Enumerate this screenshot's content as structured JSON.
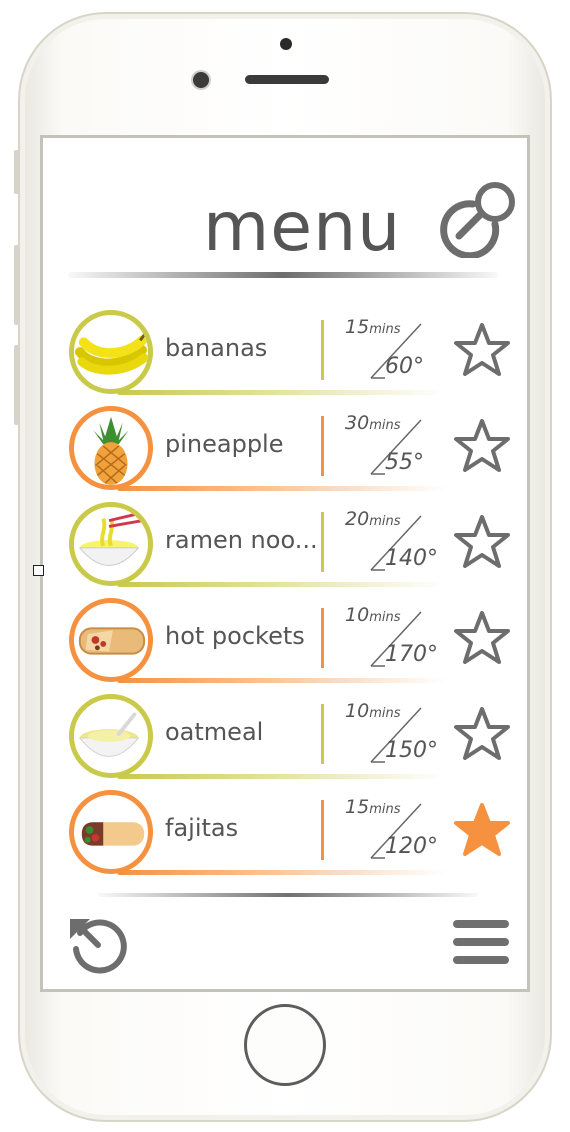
{
  "app": {
    "title": "menu"
  },
  "icons": {
    "search": "search-icon",
    "history": "history-icon",
    "menu": "hamburger-menu-icon",
    "favorite": "star-icon"
  },
  "colors": {
    "green": "#c9c94a",
    "orange": "#f5913f",
    "text": "#555555",
    "star_fill": "#f5913f"
  },
  "items": [
    {
      "name": "bananas",
      "mins": "15",
      "mins_label": "mins",
      "temp": "60°",
      "accent": "green",
      "food_icon": "banana-icon",
      "favorite": false
    },
    {
      "name": "pineapple",
      "mins": "30",
      "mins_label": "mins",
      "temp": "55°",
      "accent": "orange",
      "food_icon": "pineapple-icon",
      "favorite": false
    },
    {
      "name": "ramen noo...",
      "mins": "20",
      "mins_label": "mins",
      "temp": "140°",
      "accent": "green",
      "food_icon": "ramen-bowl-icon",
      "favorite": false
    },
    {
      "name": "hot pockets",
      "mins": "10",
      "mins_label": "mins",
      "temp": "170°",
      "accent": "orange",
      "food_icon": "hot-pocket-icon",
      "favorite": false
    },
    {
      "name": "oatmeal",
      "mins": "10",
      "mins_label": "mins",
      "temp": "150°",
      "accent": "green",
      "food_icon": "oatmeal-bowl-icon",
      "favorite": false
    },
    {
      "name": "fajitas",
      "mins": "15",
      "mins_label": "mins",
      "temp": "120°",
      "accent": "orange",
      "food_icon": "fajita-icon",
      "favorite": true
    }
  ]
}
